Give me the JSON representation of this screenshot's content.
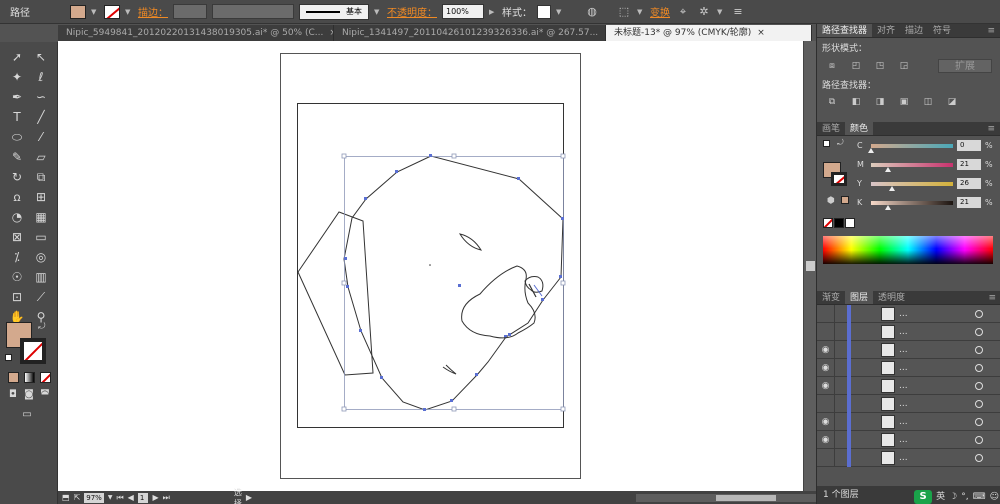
{
  "control_bar": {
    "label": "路径",
    "stroke_label": "描边：",
    "stroke_style": "基本",
    "opacity_label": "不透明度：",
    "opacity_value": "100%",
    "style_label": "样式：",
    "transform_label": "变换"
  },
  "tabs": [
    {
      "label": "Nipic_5949841_20120220131438019305.ai* @ 50% (C...",
      "close": "×"
    },
    {
      "label": "Nipic_1341497_20110426101239326336.ai* @ 267.57...",
      "close": "×"
    },
    {
      "label": "未标题-13* @ 97% (CMYK/轮廓)",
      "close": "×"
    }
  ],
  "status_bar": {
    "zoom": "97%",
    "page": "1",
    "mode": "选择"
  },
  "pathfinder_panel": {
    "tabs": [
      "路径查找器",
      "对齐",
      "描边",
      "符号"
    ],
    "shape_modes_label": "形状模式：",
    "expand_label": "扩展",
    "pathfinders_label": "路径查找器："
  },
  "color_panel": {
    "tabs": [
      "画笔",
      "颜色"
    ],
    "fill_color": "#d3a98d",
    "channels": [
      {
        "name": "C",
        "value": "0",
        "unit": "%",
        "pos": 0.0
      },
      {
        "name": "M",
        "value": "21",
        "unit": "%",
        "pos": 0.21
      },
      {
        "name": "Y",
        "value": "26",
        "unit": "%",
        "pos": 0.26
      },
      {
        "name": "K",
        "value": "21",
        "unit": "%",
        "pos": 0.21
      }
    ]
  },
  "layers_panel": {
    "tabs": [
      "渐变",
      "图层",
      "透明度"
    ],
    "row_dots": "...",
    "footer": "1 个图层"
  },
  "ime": {
    "logo": "S",
    "lang": "英"
  },
  "accent_colors": {
    "fill": "#d3a98d",
    "layer_bar": "#5b6ed0",
    "anchor": "#5a6fd2"
  }
}
